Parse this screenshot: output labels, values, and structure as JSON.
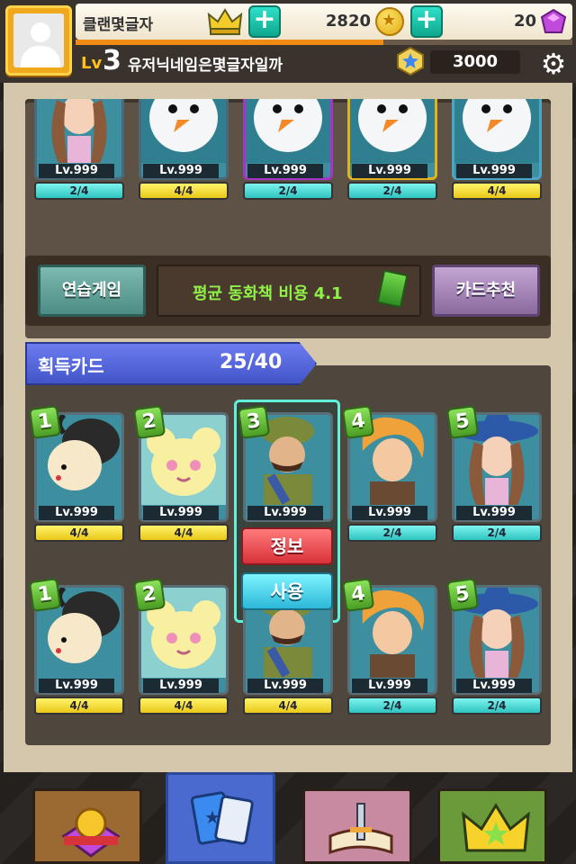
{
  "header": {
    "clan_name": "클랜몇글자",
    "coins": "2820",
    "gems": "20",
    "level_label": "Lv",
    "level": "3",
    "user_name": "유저닉네임은몇글자일까",
    "rank_points": "3000",
    "xp_progress": 0.62
  },
  "deck_cards": [
    {
      "char": "witch",
      "level": "Lv.999",
      "count": "2/4",
      "bar": "teal",
      "frame": "#4a6a7a",
      "bg": "#3d8fa0"
    },
    {
      "char": "snowman",
      "level": "Lv.999",
      "count": "4/4",
      "bar": "yellow",
      "frame": "#4a6a7a",
      "bg": "#3d8fa0"
    },
    {
      "char": "snowman",
      "level": "Lv.999",
      "count": "2/4",
      "bar": "teal",
      "frame": "#a634c6",
      "bg": "#3d8fa0"
    },
    {
      "char": "snowman",
      "level": "Lv.999",
      "count": "2/4",
      "bar": "teal",
      "frame": "#e0b21c",
      "bg": "#3d8fa0"
    },
    {
      "char": "snowman",
      "level": "Lv.999",
      "count": "4/4",
      "bar": "yellow",
      "frame": "#4aa6c6",
      "bg": "#3d8fa0"
    }
  ],
  "middle": {
    "practice_label": "연습게임",
    "average_cost": "평균 동화책 비용 4.1",
    "recommend_label": "카드추천"
  },
  "owned": {
    "title": "획득카드",
    "count": "25/40",
    "info_label": "정보",
    "use_label": "사용",
    "cards": [
      {
        "badge": "1",
        "char": "goat",
        "level": "Lv.999",
        "count": "4/4",
        "bar": "yellow"
      },
      {
        "badge": "2",
        "char": "bear",
        "level": "Lv.999",
        "count": "4/4",
        "bar": "yellow"
      },
      {
        "badge": "3",
        "char": "soldier",
        "level": "Lv.999",
        "count": "",
        "bar": "none"
      },
      {
        "badge": "4",
        "char": "boy",
        "level": "Lv.999",
        "count": "2/4",
        "bar": "teal"
      },
      {
        "badge": "5",
        "char": "witch",
        "level": "Lv.999",
        "count": "2/4",
        "bar": "teal"
      },
      {
        "badge": "1",
        "char": "goat",
        "level": "Lv.999",
        "count": "4/4",
        "bar": "yellow"
      },
      {
        "badge": "2",
        "char": "bear",
        "level": "Lv.999",
        "count": "4/4",
        "bar": "yellow"
      },
      {
        "badge": "",
        "char": "soldier",
        "level": "Lv.999",
        "count": "4/4",
        "bar": "yellow"
      },
      {
        "badge": "4",
        "char": "boy",
        "level": "Lv.999",
        "count": "2/4",
        "bar": "teal"
      },
      {
        "badge": "5",
        "char": "witch",
        "level": "Lv.999",
        "count": "2/4",
        "bar": "teal"
      }
    ]
  },
  "nav": {
    "tabs": [
      {
        "icon": "shop-coin-icon",
        "color": "#9a6a32",
        "active": false
      },
      {
        "icon": "cards-book-icon",
        "color": "#4a6ad0",
        "active": true
      },
      {
        "icon": "storybook-sword-icon",
        "color": "#c88aa0",
        "active": false
      },
      {
        "icon": "crown-star-icon",
        "color": "#6a9a3a",
        "active": false
      }
    ]
  }
}
